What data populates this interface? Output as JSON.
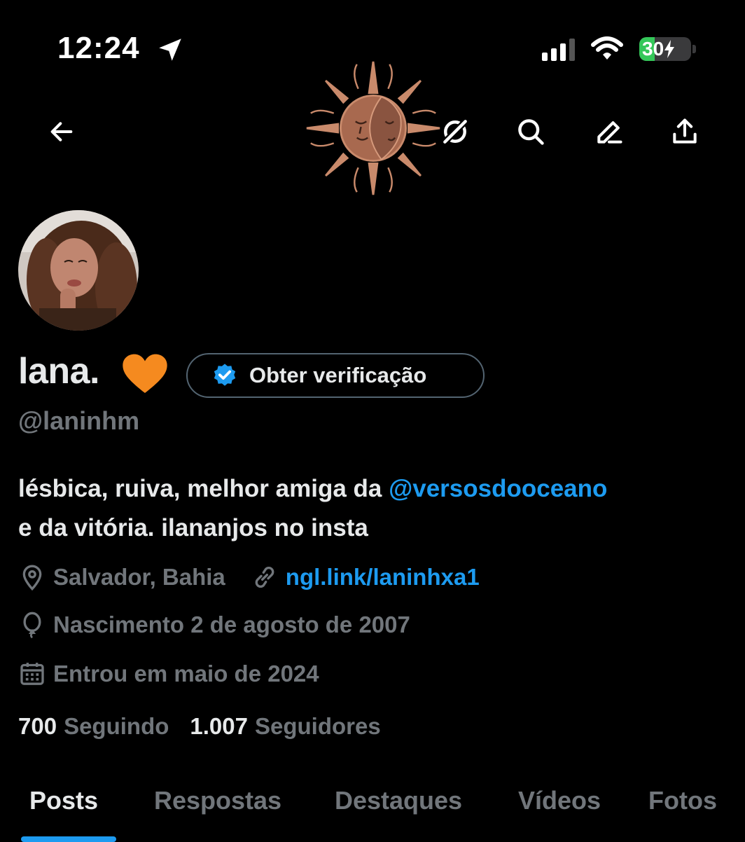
{
  "status_bar": {
    "time": "12:24",
    "battery_percent": "30",
    "battery_level": 0.3,
    "signal_bars_active": 3,
    "signal_bars_total": 4
  },
  "header": {
    "back_icon": "arrow-left-icon",
    "actions": [
      "grok-icon",
      "search-icon",
      "edit-icon",
      "share-icon"
    ]
  },
  "profile": {
    "display_name": "lana.",
    "name_emoji_icon": "orange-heart-icon",
    "verify_button_label": "Obter verificação",
    "handle": "@laninhm",
    "bio_prefix": "lésbica, ruiva, melhor amiga da",
    "bio_mention": "@versosdooceano",
    "bio_suffix": "e da vitória. ilananjos no insta",
    "location": "Salvador, Bahia",
    "website": "ngl.link/laninhxa1",
    "birthday": "Nascimento 2 de agosto de 2007",
    "joined": "Entrou em maio de 2024",
    "following_count": "700",
    "following_label": "Seguindo",
    "followers_count": "1.007",
    "followers_label": "Seguidores"
  },
  "tabs": [
    {
      "label": "Posts",
      "active": true
    },
    {
      "label": "Respostas",
      "active": false
    },
    {
      "label": "Destaques",
      "active": false
    },
    {
      "label": "Vídeos",
      "active": false
    },
    {
      "label": "Fotos",
      "active": false
    }
  ],
  "colors": {
    "background": "#000000",
    "text": "#e7e9ea",
    "muted": "#71767b",
    "accent": "#1d9bf0",
    "battery": "#34c759",
    "sun": "#c98a6b"
  }
}
